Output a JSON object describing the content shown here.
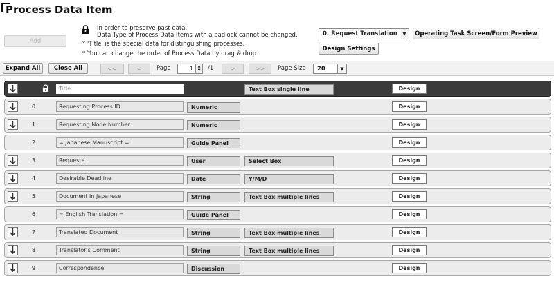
{
  "header": {
    "title": "Process Data Item"
  },
  "actions": {
    "add_label": "Add"
  },
  "notice": {
    "line1": "In order to preserve past data,",
    "line2": "Data Type of Process Data Items with a padlock cannot be changed.",
    "line3": "* 'Title' is the special data for distinguishing processes.",
    "line4": "* You can change the order of Process Data by drag & drop."
  },
  "controls": {
    "node_select": "0. Request Translation",
    "preview_label": "Operating Task Screen/Form Preview",
    "design_settings_label": "Design Settings"
  },
  "toolbar": {
    "expand_all": "Expand All",
    "close_all": "Close All",
    "first": "<<",
    "prev": "<",
    "page_label": "Page",
    "page_value": "1",
    "page_total": "/1",
    "next": ">",
    "last": ">>",
    "page_size_label": "Page Size",
    "page_size_value": "20"
  },
  "rows": [
    {
      "index": "",
      "name": "Title",
      "type": "",
      "sub": "Text Box single line",
      "design": "Design",
      "locked": true
    },
    {
      "index": "0",
      "name": "Requesting Process ID",
      "type": "Numeric",
      "sub": "",
      "design": "Design"
    },
    {
      "index": "1",
      "name": "Requesting Node Number",
      "type": "Numeric",
      "sub": "",
      "design": "Design"
    },
    {
      "index": "2",
      "name": "= Japanese Manuscript =",
      "type": "Guide Panel",
      "sub": "",
      "design": "Design"
    },
    {
      "index": "3",
      "name": "Requeste",
      "type": "User",
      "sub": "Select Box",
      "design": "Design"
    },
    {
      "index": "4",
      "name": "Desirable Deadline",
      "type": "Date",
      "sub": "Y/M/D",
      "design": "Design"
    },
    {
      "index": "5",
      "name": "Document in Japanese",
      "type": "String",
      "sub": "Text Box multiple lines",
      "design": "Design"
    },
    {
      "index": "6",
      "name": "= English Translation =",
      "type": "Guide Panel",
      "sub": "",
      "design": "Design"
    },
    {
      "index": "7",
      "name": "Translated Document",
      "type": "String",
      "sub": "Text Box multiple lines",
      "design": "Design"
    },
    {
      "index": "8",
      "name": "Translator's Comment",
      "type": "String",
      "sub": "Text Box multiple lines",
      "design": "Design"
    },
    {
      "index": "9",
      "name": "Correspondence",
      "type": "Discussion",
      "sub": "",
      "design": "Design"
    }
  ],
  "colors": {
    "title_row_bg": "#3a3a3a",
    "row_bg": "#ececec",
    "type_bg": "#d9d9d9"
  },
  "icons": {
    "lock": "padlock-icon",
    "drag": "arrow-down-icon"
  }
}
